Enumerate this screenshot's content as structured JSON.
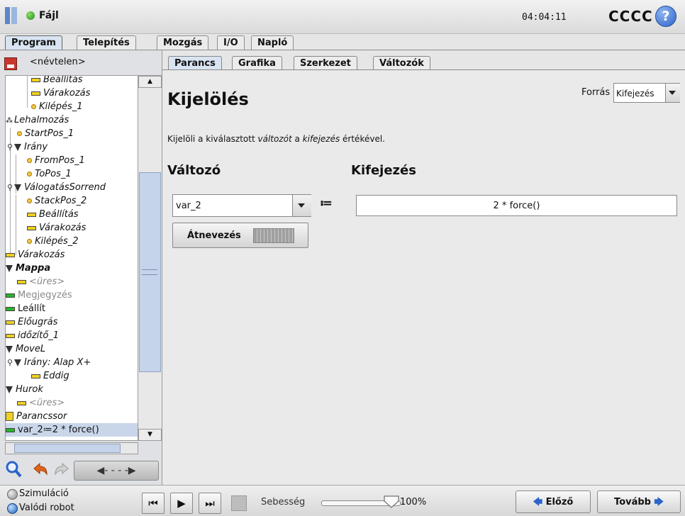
{
  "titlebar": {
    "file_menu": "Fájl",
    "clock": "04:04:11",
    "robot_name": "CCCC",
    "help_glyph": "?"
  },
  "main_tabs": [
    "Program",
    "Telepítés",
    "Mozgás",
    "I/O",
    "Napló"
  ],
  "left_panel": {
    "filename": "<névtelen>",
    "tree": [
      {
        "label": "Beállítás",
        "icon": "line-yellow"
      },
      {
        "label": "Várakozás",
        "icon": "line-yellow"
      },
      {
        "label": "Kilépés_1",
        "icon": "waypoint-dot"
      },
      {
        "label": "Lehalmozás",
        "icon": "stack-icon"
      },
      {
        "label": "StartPos_1",
        "icon": "waypoint-dot"
      },
      {
        "label": "Irány",
        "icon": "triangle"
      },
      {
        "label": "FromPos_1",
        "icon": "waypoint-dot"
      },
      {
        "label": "ToPos_1",
        "icon": "waypoint-dot"
      },
      {
        "label": "VálogatásSorrend",
        "icon": "triangle"
      },
      {
        "label": "StackPos_2",
        "icon": "waypoint-dot"
      },
      {
        "label": "Beállítás",
        "icon": "line-yellow"
      },
      {
        "label": "Várakozás",
        "icon": "line-yellow"
      },
      {
        "label": "Kilépés_2",
        "icon": "waypoint-dot"
      },
      {
        "label": "Várakozás",
        "icon": "line-yellow"
      },
      {
        "label": "Mappa",
        "icon": "triangle"
      },
      {
        "label": "<üres>",
        "icon": "line-yellow"
      },
      {
        "label": "Megjegyzés",
        "icon": "line-green"
      },
      {
        "label": "Leállít",
        "icon": "line-green"
      },
      {
        "label": "Előugrás",
        "icon": "line-yellow"
      },
      {
        "label": "időzítő_1",
        "icon": "line-yellow"
      },
      {
        "label": "MoveL",
        "icon": "triangle"
      },
      {
        "label": "Irány: Alap X+",
        "icon": "triangle"
      },
      {
        "label": "Eddig",
        "icon": "line-yellow"
      },
      {
        "label": "Hurok",
        "icon": "triangle"
      },
      {
        "label": "<üres>",
        "icon": "line-yellow"
      },
      {
        "label": "Parancssor",
        "icon": "script-icon"
      },
      {
        "label": "var_2≔2 * force()",
        "icon": "line-green"
      }
    ]
  },
  "sub_tabs": [
    "Parancs",
    "Grafika",
    "Szerkezet",
    "Változók"
  ],
  "command": {
    "title": "Kijelölés",
    "source_label": "Forrás",
    "source_value": "Kifejezés",
    "description_parts": [
      "Kijelöli a kiválasztott ",
      "változót",
      " a ",
      "kifejezés",
      " értékével."
    ],
    "variable_heading": "Változó",
    "expression_heading": "Kifejezés",
    "variable_value": "var_2",
    "assign_operator": "≔",
    "expression_value": "2 * force()",
    "rename_button": "Átnevezés"
  },
  "footer": {
    "simulation_label": "Szimuláció",
    "real_robot_label": "Valódi robot",
    "speed_label": "Sebesség",
    "speed_value": "100%",
    "speed_fraction": 1.0,
    "prev_button": "Előző",
    "next_button": "Tovább"
  },
  "colors": {
    "active_tab": "#d9e4f2",
    "selection": "#c9d5e9",
    "accent_blue": "#2c63c9",
    "status_green": "#26b626"
  }
}
